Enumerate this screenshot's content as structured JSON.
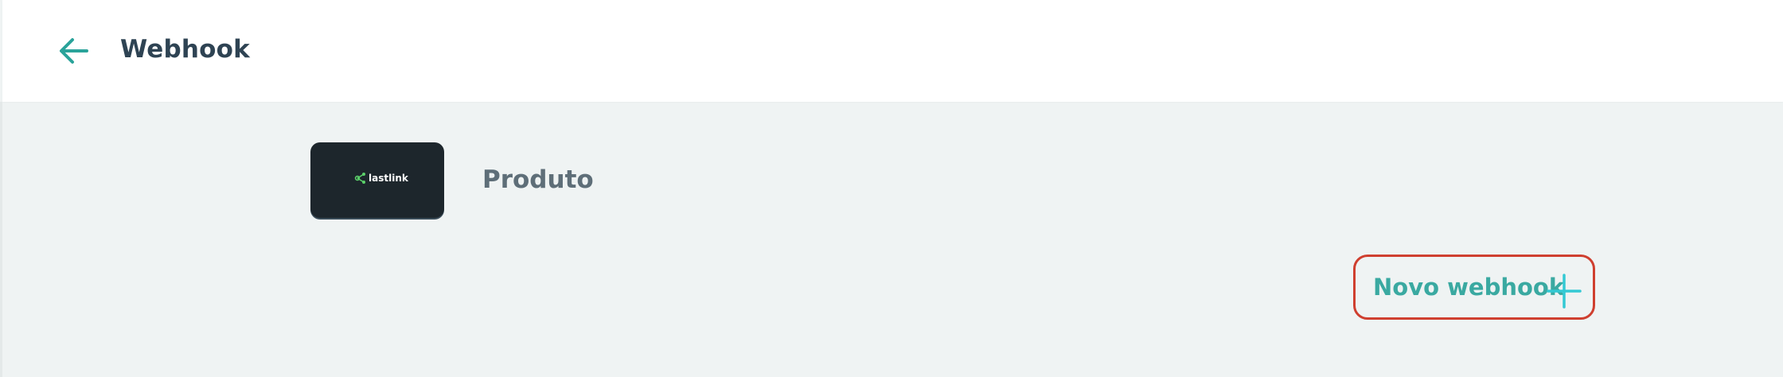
{
  "header": {
    "title": "Webhook",
    "back_icon": "arrow-left-icon"
  },
  "product": {
    "name": "Produto",
    "thumbnail_brand": "lastlink"
  },
  "actions": {
    "new_webhook_label": "Novo webhook",
    "new_webhook_icon": "plus-icon"
  },
  "colors": {
    "accent": "#2aa39a",
    "title_text": "#2e4353",
    "page_background": "#eff3f3",
    "thumbnail_background": "#1d262c",
    "highlight_border": "#cf3f2f",
    "plus_icon": "#33c9d4",
    "brand_green": "#5bd06a"
  }
}
